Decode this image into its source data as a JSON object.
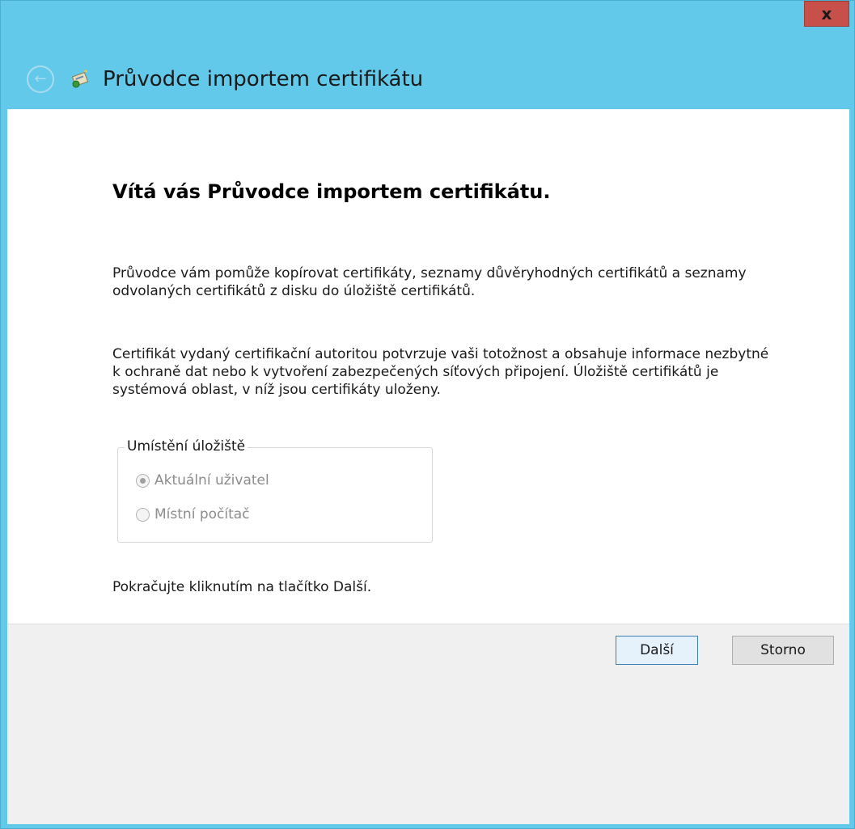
{
  "window": {
    "title": "Průvodce importem certifikátu",
    "close_label": "x"
  },
  "content": {
    "heading": "Vítá vás Průvodce importem certifikátu.",
    "paragraph1": "Průvodce vám pomůže kopírovat certifikáty, seznamy důvěryhodných certifikátů a seznamy odvolaných certifikátů z disku do úložiště certifikátů.",
    "paragraph2": "Certifikát vydaný certifikační autoritou potvrzuje vaši totožnost a obsahuje informace nezbytné k ochraně dat nebo k vytvoření zabezpečených síťových připojení. Úložiště certifikátů je systémová oblast, v níž jsou certifikáty uloženy.",
    "store_location": {
      "legend": "Umístění úložiště",
      "options": [
        {
          "label": "Aktuální uživatel",
          "checked": true
        },
        {
          "label": "Místní počítač",
          "checked": false
        }
      ]
    },
    "continue_text": "Pokračujte kliknutím na tlačítko Další."
  },
  "footer": {
    "next_label": "Další",
    "cancel_label": "Storno"
  },
  "colors": {
    "titlebar": "#62c9ea",
    "close": "#c7504a",
    "content_bg": "#ffffff",
    "footer_bg": "#f0f0f0"
  },
  "icons": {
    "back": "back-arrow-icon",
    "wizard": "certificate-wizard-icon"
  }
}
